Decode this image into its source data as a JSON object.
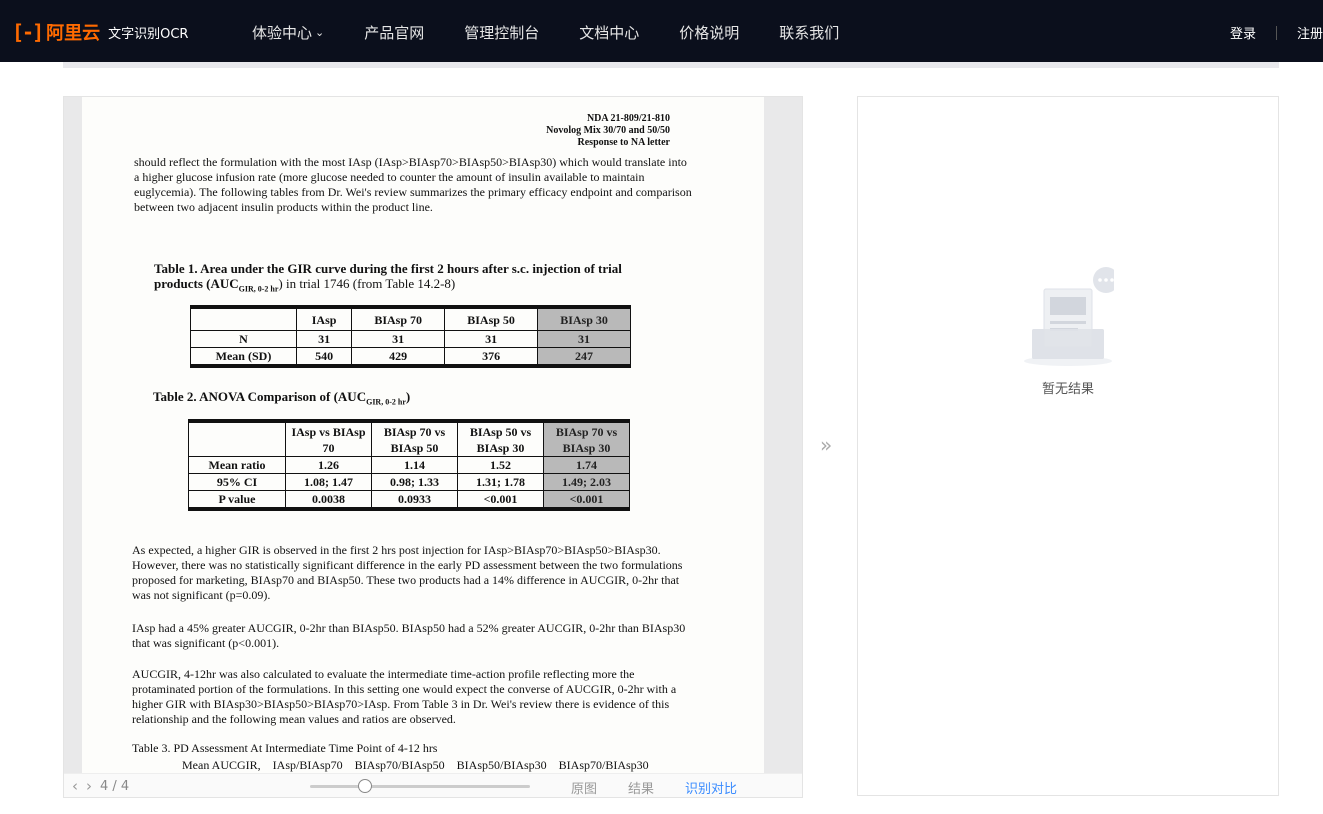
{
  "nav": {
    "logo_mark": "[-]",
    "logo_brand": "阿里云",
    "product": "文字识别OCR",
    "items": [
      {
        "label": "体验中心",
        "has_dropdown": true
      },
      {
        "label": "产品官网"
      },
      {
        "label": "管理控制台"
      },
      {
        "label": "文档中心"
      },
      {
        "label": "价格说明"
      },
      {
        "label": "联系我们"
      }
    ],
    "login": "登录",
    "register": "注册"
  },
  "document": {
    "header": [
      "NDA 21-809/21-810",
      "Novolog Mix 30/70 and 50/50",
      "Response to NA letter"
    ],
    "para1": "should reflect the formulation with the most IAsp (IAsp>BIAsp70>BIAsp50>BIAsp30) which would translate into a higher glucose infusion rate (more glucose needed to counter the amount of insulin available to maintain euglycemia). The following tables from Dr. Wei's review summarizes the primary efficacy endpoint and comparison between two adjacent insulin products within the product line.",
    "table1_caption": "Table 1. Area under the GIR curve during the first 2 hours after s.c. injection of trial products (AUC",
    "table1_caption_sub": "GIR, 0-2 hr",
    "table1_caption_end": ") in trial 1746 (from Table 14.2-8)",
    "table1": {
      "headers": [
        "",
        "IAsp",
        "BIAsp 70",
        "BIAsp 50",
        "BIAsp 30"
      ],
      "rows": [
        [
          "N",
          "31",
          "31",
          "31",
          "31"
        ],
        [
          "Mean (SD)",
          "540",
          "429",
          "376",
          "247"
        ]
      ]
    },
    "table2_caption": "Table 2. ANOVA Comparison of (AUC",
    "table2_caption_sub": "GIR, 0-2 hr",
    "table2_caption_end": ")",
    "table2": {
      "headers": [
        "",
        "IAsp vs BIAsp 70",
        "BIAsp 70 vs BIAsp 50",
        "BIAsp 50 vs BIAsp 30",
        "BIAsp 70 vs BIAsp 30"
      ],
      "rows": [
        [
          "Mean ratio",
          "1.26",
          "1.14",
          "1.52",
          "1.74"
        ],
        [
          "95% CI",
          "1.08; 1.47",
          "0.98; 1.33",
          "1.31; 1.78",
          "1.49; 2.03"
        ],
        [
          "P value",
          "0.0038",
          "0.0933",
          "<0.001",
          "<0.001"
        ]
      ]
    },
    "para2": "As expected, a higher GIR is observed in the first 2 hrs post injection for IAsp>BIAsp70>BIAsp50>BIAsp30. However, there was no statistically significant difference in the early PD assessment between the two formulations proposed for marketing, BIAsp70 and BIAsp50. These two products had a 14% difference in AUCGIR, 0-2hr that was not significant (p=0.09).",
    "para3": "IAsp had a 45% greater AUCGIR, 0-2hr than BIAsp50. BIAsp50 had a 52% greater AUCGIR, 0-2hr than BIAsp30 that was significant (p<0.001).",
    "para4": "AUCGIR, 4-12hr was also calculated to evaluate the intermediate time-action profile reflecting more the protaminated portion of the formulations. In this setting one would expect the converse of AUCGIR, 0-2hr with a higher GIR with BIAsp30>BIAsp50>BIAsp70>IAsp. From Table 3 in Dr. Wei's review there is evidence of this relationship and the following mean values and ratios are observed.",
    "table3_caption": "Table 3. PD Assessment At Intermediate Time Point of 4-12 hrs",
    "table3_header": "Mean AUCGIR,    IAsp/BIAsp70    BIAsp70/BIAsp50    BIAsp50/BIAsp30    BIAsp70/BIAsp30"
  },
  "viewer_bar": {
    "page_indicator": "4 / 4",
    "zoom_fraction": 0.25,
    "tabs": [
      {
        "label": "原图",
        "active": false
      },
      {
        "label": "结果",
        "active": false
      },
      {
        "label": "识别对比",
        "active": true
      }
    ]
  },
  "result_panel": {
    "empty_text": "暂无结果"
  },
  "colors": {
    "nav_bg": "#0b0f1c",
    "brand_orange": "#ff6a00",
    "active_tab": "#3b8cff"
  }
}
